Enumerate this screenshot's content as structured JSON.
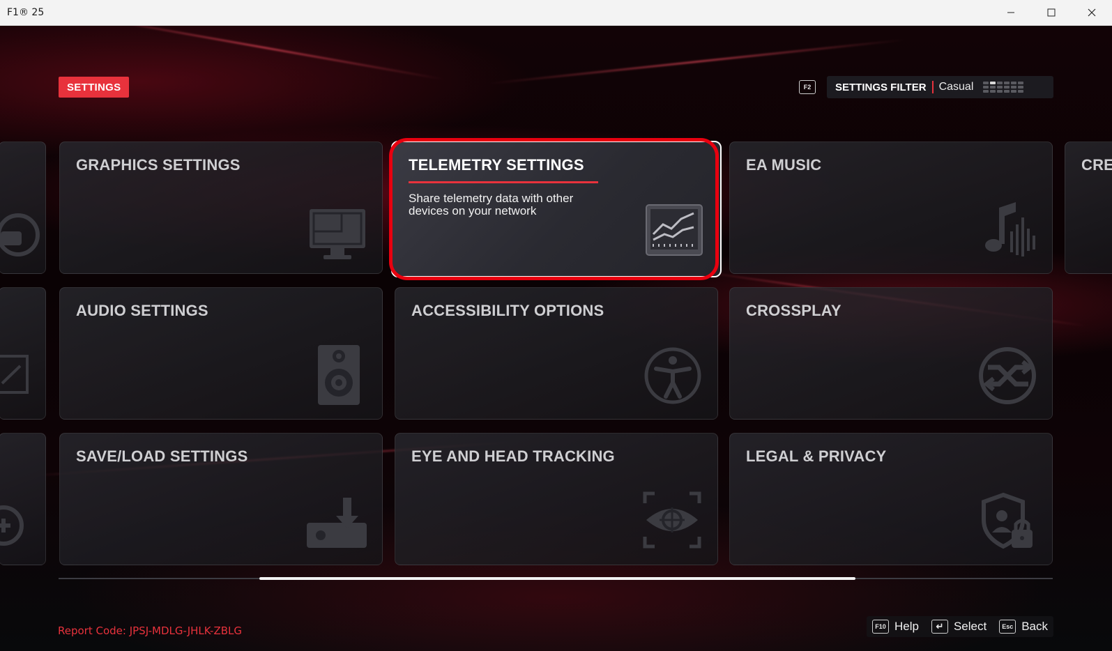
{
  "window": {
    "title": "F1® 25",
    "minimize_glyph": "—",
    "maximize_glyph": "☐",
    "close_glyph": "✕"
  },
  "header": {
    "section_tag": "SETTINGS",
    "filter_key": "F2",
    "filter_label": "SETTINGS FILTER",
    "filter_value": "Casual"
  },
  "tiles": {
    "graphics": {
      "title": "GRAPHICS SETTINGS",
      "icon": "monitor-icon"
    },
    "telemetry": {
      "title": "TELEMETRY SETTINGS",
      "description": "Share telemetry data with other devices on your network",
      "icon": "telemetry-chart-icon",
      "selected": true
    },
    "ea_music": {
      "title": "EA MUSIC",
      "icon": "music-note-icon"
    },
    "partial_right": {
      "title": "CRE"
    },
    "audio": {
      "title": "AUDIO SETTINGS",
      "icon": "speaker-icon"
    },
    "accessibility": {
      "title": "ACCESSIBILITY OPTIONS",
      "icon": "accessibility-icon"
    },
    "crossplay": {
      "title": "CROSSPLAY",
      "icon": "crossplay-icon"
    },
    "save_load": {
      "title": "SAVE/LOAD SETTINGS",
      "icon": "save-download-icon"
    },
    "eye_tracking": {
      "title": "EYE AND HEAD TRACKING",
      "icon": "eye-target-icon"
    },
    "legal": {
      "title": "LEGAL & PRIVACY",
      "icon": "shield-lock-icon"
    }
  },
  "footer": {
    "report_code": "Report Code: JPSJ-MDLG-JHLK-ZBLG",
    "actions": [
      {
        "key": "F10",
        "label": "Help"
      },
      {
        "key": "↵",
        "label": "Select"
      },
      {
        "key": "Esc",
        "label": "Back"
      }
    ]
  },
  "colors": {
    "accent": "#e8323c",
    "highlight_ring": "#e8000f",
    "tile_text": "#cfcfd2"
  }
}
